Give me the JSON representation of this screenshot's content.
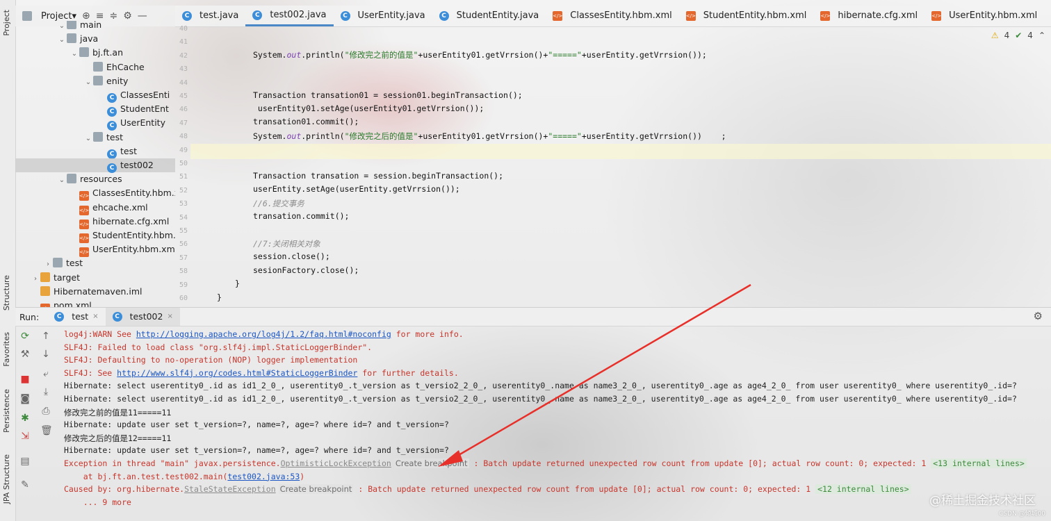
{
  "left_strip": {
    "tabs": [
      "Project",
      "Structure",
      "Favorites",
      "Persistence",
      "JPA Structure"
    ]
  },
  "project": {
    "title": "Project▾",
    "tree": [
      {
        "label": "main",
        "kind": "folder",
        "expanded": true
      },
      {
        "label": "java",
        "kind": "folder",
        "expanded": true
      },
      {
        "label": "bj.ft.an",
        "kind": "pkg",
        "expanded": true
      },
      {
        "label": "EhCache",
        "kind": "pkg",
        "expanded": false
      },
      {
        "label": "enity",
        "kind": "pkg",
        "expanded": true
      },
      {
        "label": "ClassesEnti",
        "kind": "class"
      },
      {
        "label": "StudentEnt",
        "kind": "class"
      },
      {
        "label": "UserEntity",
        "kind": "class"
      },
      {
        "label": "test",
        "kind": "pkg",
        "expanded": true
      },
      {
        "label": "test",
        "kind": "class"
      },
      {
        "label": "test002",
        "kind": "class",
        "selected": true
      },
      {
        "label": "resources",
        "kind": "folder",
        "expanded": true
      },
      {
        "label": "ClassesEntity.hbm.xm",
        "kind": "xml"
      },
      {
        "label": "ehcache.xml",
        "kind": "xml"
      },
      {
        "label": "hibernate.cfg.xml",
        "kind": "xml"
      },
      {
        "label": "StudentEntity.hbm.xı",
        "kind": "xml"
      },
      {
        "label": "UserEntity.hbm.xml",
        "kind": "xml"
      },
      {
        "label": "test",
        "kind": "folder",
        "expanded": false
      },
      {
        "label": "target",
        "kind": "folder-orange",
        "expanded": false
      },
      {
        "label": "Hibernatemaven.iml",
        "kind": "iml"
      },
      {
        "label": "pom.xml",
        "kind": "xml"
      }
    ]
  },
  "editor": {
    "tabs": [
      {
        "label": "test.java",
        "kind": "class"
      },
      {
        "label": "test002.java",
        "kind": "class",
        "active": true
      },
      {
        "label": "UserEntity.java",
        "kind": "class"
      },
      {
        "label": "StudentEntity.java",
        "kind": "class"
      },
      {
        "label": "ClassesEntity.hbm.xml",
        "kind": "xml"
      },
      {
        "label": "StudentEntity.hbm.xml",
        "kind": "xml"
      },
      {
        "label": "hibernate.cfg.xml",
        "kind": "xml"
      },
      {
        "label": "UserEntity.hbm.xml",
        "kind": "xml"
      }
    ],
    "warnings": {
      "warn_count": "4",
      "ok_count": "4"
    },
    "line_numbers": [
      "40",
      "41",
      "42",
      "43",
      "44",
      "45",
      "46",
      "47",
      "48",
      "49",
      "50",
      "51",
      "52",
      "53",
      "54",
      "55",
      "56",
      "57",
      "58",
      "59",
      "60"
    ],
    "code": [
      {
        "ln": "41",
        "parts": [
          [
            "",
            "System."
          ],
          [
            "fld",
            "out"
          ],
          [
            "",
            ".println("
          ],
          [
            "str",
            "\"修改完之前的值是\""
          ],
          [
            "",
            "+userEntity01.getVrrsion()+"
          ],
          [
            "str",
            "\"=====\""
          ],
          [
            "",
            "+userEntity.getVrrsion());"
          ]
        ]
      },
      {
        "ln": "44",
        "parts": [
          [
            "",
            "Transaction transation01 = session01.beginTransaction();"
          ]
        ]
      },
      {
        "ln": "45",
        "parts": [
          [
            "",
            " userEntity01.setAge(userEntity01.getVrrsion());"
          ]
        ]
      },
      {
        "ln": "46",
        "parts": [
          [
            "",
            "transation01.commit();"
          ]
        ]
      },
      {
        "ln": "47",
        "parts": [
          [
            "",
            "System."
          ],
          [
            "fld",
            "out"
          ],
          [
            "",
            ".println("
          ],
          [
            "str",
            "\"修改完之后的值是\""
          ],
          [
            "",
            "+userEntity01.getVrrsion()+"
          ],
          [
            "str",
            "\"=====\""
          ],
          [
            "",
            "+userEntity.getVrrsion())    ;"
          ]
        ]
      },
      {
        "ln": "50",
        "parts": [
          [
            "",
            "Transaction transation = session.beginTransaction();"
          ]
        ]
      },
      {
        "ln": "51",
        "parts": [
          [
            "",
            "userEntity.setAge(userEntity.getVrrsion());"
          ]
        ]
      },
      {
        "ln": "52",
        "parts": [
          [
            "cm",
            "//6.提交事务"
          ]
        ]
      },
      {
        "ln": "53",
        "parts": [
          [
            "",
            "transation.commit();"
          ]
        ]
      },
      {
        "ln": "55",
        "parts": [
          [
            "cm",
            "//7:关闭相关对象"
          ]
        ]
      },
      {
        "ln": "56",
        "parts": [
          [
            "",
            "session.close();"
          ]
        ]
      },
      {
        "ln": "57",
        "parts": [
          [
            "",
            "sesionFactory.close();"
          ]
        ]
      },
      {
        "ln": "58",
        "parts": [
          [
            "",
            "}"
          ]
        ],
        "indent": "brace1"
      },
      {
        "ln": "59",
        "parts": [
          [
            "",
            "}"
          ]
        ],
        "indent": "brace0"
      }
    ]
  },
  "run": {
    "label": "Run:",
    "tabs": [
      {
        "label": "test"
      },
      {
        "label": "test002",
        "active": true
      }
    ],
    "console": [
      {
        "color": "red",
        "parts": [
          [
            "",
            "log4j:WARN See "
          ],
          [
            "link",
            "http://logging.apache.org/log4j/1.2/faq.html#noconfig"
          ],
          [
            "",
            " for more info."
          ]
        ]
      },
      {
        "color": "red",
        "parts": [
          [
            "",
            "SLF4J: Failed to load class \"org.slf4j.impl.StaticLoggerBinder\"."
          ]
        ]
      },
      {
        "color": "red",
        "parts": [
          [
            "",
            "SLF4J: Defaulting to no-operation (NOP) logger implementation"
          ]
        ]
      },
      {
        "color": "red",
        "parts": [
          [
            "",
            "SLF4J: See "
          ],
          [
            "link",
            "http://www.slf4j.org/codes.html#StaticLoggerBinder"
          ],
          [
            "",
            " for further details."
          ]
        ]
      },
      {
        "color": "normal",
        "parts": [
          [
            "",
            "Hibernate: select userentity0_.id as id1_2_0_, userentity0_.t_version as t_versio2_2_0_, userentity0_.name as name3_2_0_, userentity0_.age as age4_2_0_ from user userentity0_ where userentity0_.id=?"
          ]
        ]
      },
      {
        "color": "normal",
        "parts": [
          [
            "",
            "Hibernate: select userentity0_.id as id1_2_0_, userentity0_.t_version as t_versio2_2_0_, userentity0_.name as name3_2_0_, userentity0_.age as age4_2_0_ from user userentity0_ where userentity0_.id=?"
          ]
        ]
      },
      {
        "color": "normal",
        "parts": [
          [
            "",
            "修改完之前的值是11=====11"
          ]
        ]
      },
      {
        "color": "normal",
        "parts": [
          [
            "",
            "Hibernate: update user set t_version=?, name=?, age=? where id=? and t_version=?"
          ]
        ]
      },
      {
        "color": "normal",
        "parts": [
          [
            "",
            "修改完之后的值是12=====11"
          ]
        ]
      },
      {
        "color": "normal",
        "parts": [
          [
            "",
            "Hibernate: update user set t_version=?, name=?, age=? where id=? and t_version=?"
          ]
        ]
      },
      {
        "color": "red",
        "parts": [
          [
            "",
            "Exception in thread \"main\" javax.persistence."
          ],
          [
            "linkgray",
            "OptimisticLockException"
          ],
          [
            "bp",
            "Create breakpoint"
          ],
          [
            "",
            " : Batch update returned unexpected row count from update [0]; actual row count: 0; expected: 1 "
          ],
          [
            "inl",
            "<13 internal lines>"
          ]
        ]
      },
      {
        "color": "red",
        "parts": [
          [
            "",
            "    at bj.ft.an.test.test002.main("
          ],
          [
            "link",
            "test002.java:53"
          ],
          [
            "",
            ")"
          ]
        ]
      },
      {
        "color": "red",
        "parts": [
          [
            "",
            "Caused by: org.hibernate."
          ],
          [
            "linkgray",
            "StaleStateException"
          ],
          [
            "bp",
            "Create breakpoint"
          ],
          [
            "",
            " : Batch update returned unexpected row count from update [0]; actual row count: 0; expected: 1 "
          ],
          [
            "inl",
            "<12 internal lines>"
          ]
        ]
      },
      {
        "color": "red",
        "parts": [
          [
            "",
            "    ... 9 more"
          ]
        ]
      }
    ]
  },
  "watermark": {
    "main": "@稀土掘金技术社区",
    "small": "CSDN @倾城00"
  },
  "colors": {
    "accent": "#4a88c7",
    "error": "#c8352b",
    "link": "#1a56c4",
    "arrow": "#e8302a"
  }
}
